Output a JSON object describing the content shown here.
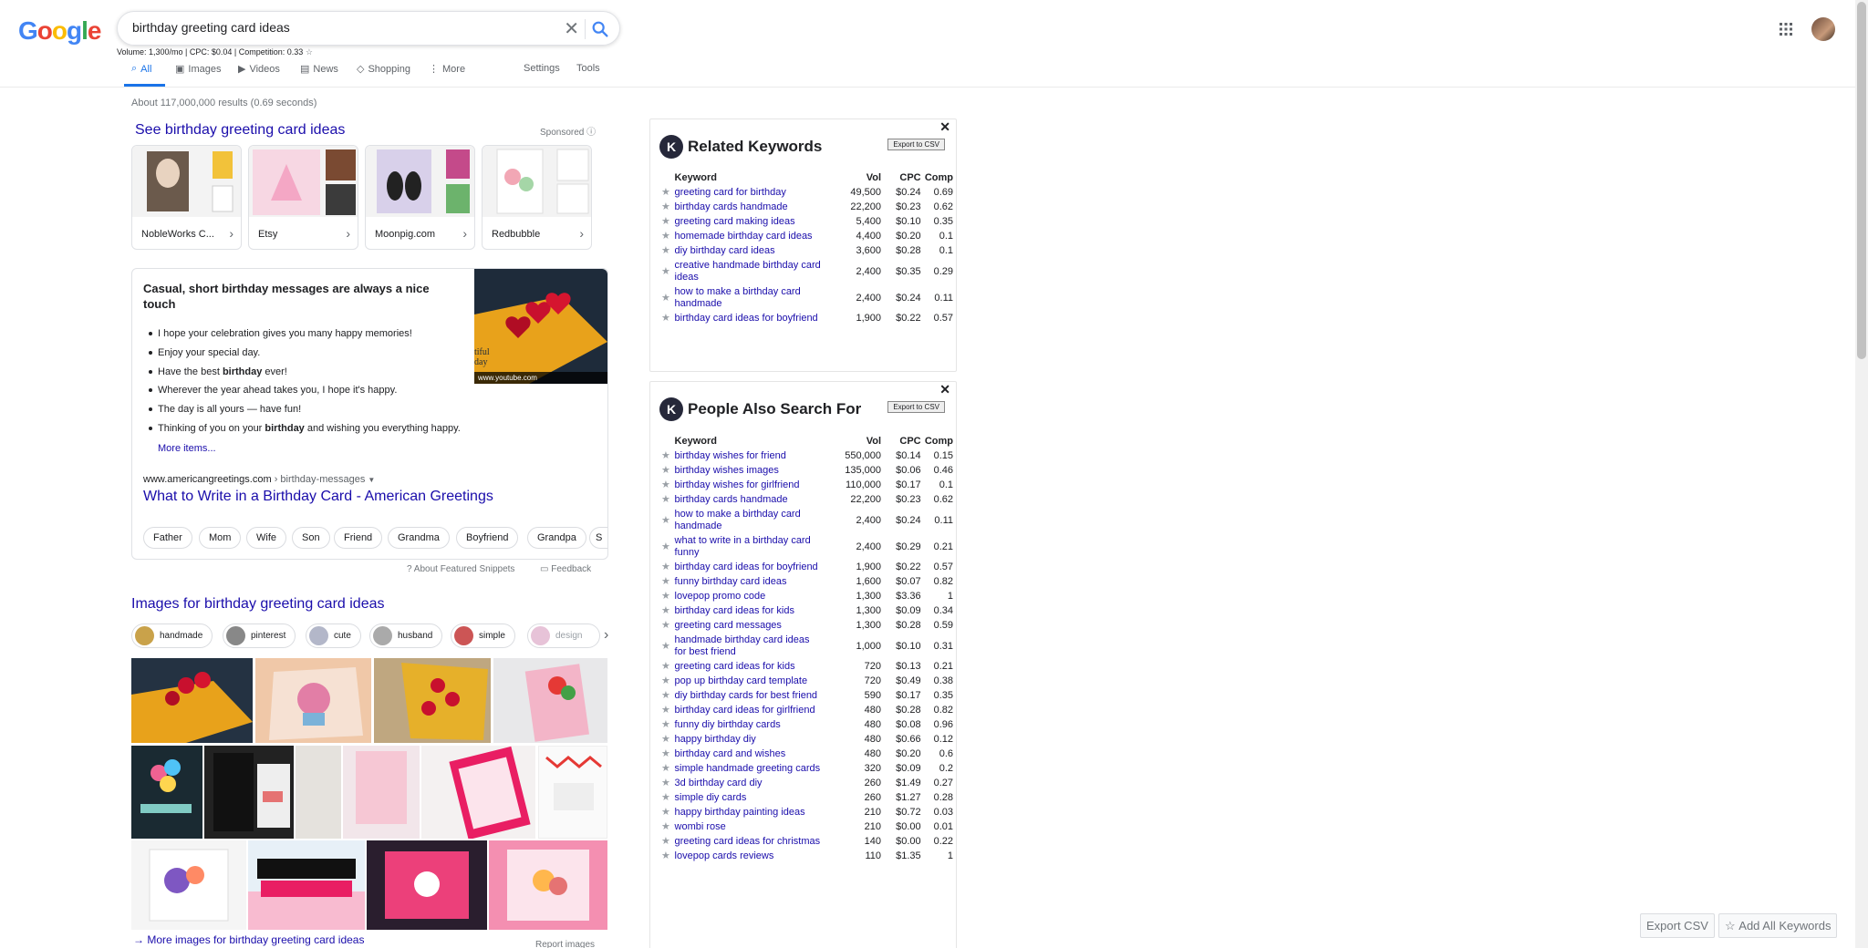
{
  "header": {
    "logo_letters": [
      "G",
      "o",
      "o",
      "g",
      "l",
      "e"
    ],
    "search_value": "birthday greeting card ideas",
    "volume_line": "Volume: 1,300/mo | CPC: $0.04 | Competition: 0.33"
  },
  "tabs": [
    {
      "label": "All",
      "icon": "search-icon"
    },
    {
      "label": "Images",
      "icon": "image-icon"
    },
    {
      "label": "Videos",
      "icon": "video-icon"
    },
    {
      "label": "News",
      "icon": "news-icon"
    },
    {
      "label": "Shopping",
      "icon": "tag-icon"
    },
    {
      "label": "More",
      "icon": "more-icon"
    },
    {
      "label": "Settings",
      "icon": ""
    },
    {
      "label": "Tools",
      "icon": ""
    }
  ],
  "results_count": "About 117,000,000 results (0.69 seconds)",
  "sponsored": {
    "title": "See birthday greeting card ideas",
    "label": "Sponsored",
    "cards": [
      {
        "name": "NobleWorks C..."
      },
      {
        "name": "Etsy"
      },
      {
        "name": "Moonpig.com"
      },
      {
        "name": "Redbubble"
      }
    ]
  },
  "snippet": {
    "heading_parts": [
      "Casual, short ",
      "birthday",
      " messages are always a nice touch"
    ],
    "items": [
      [
        "I hope your celebration gives you many happy memories!"
      ],
      [
        "Enjoy your special day."
      ],
      [
        "Have the best ",
        "birthday",
        " ever!"
      ],
      [
        "Wherever the year ahead takes you, I hope it's happy."
      ],
      [
        "The day is all yours — have fun!"
      ],
      [
        "Thinking of you on your ",
        "birthday",
        " and wishing you everything happy."
      ]
    ],
    "image_caption": "www.youtube.com",
    "image_text": "tiful day",
    "more_items": "More items...",
    "site_domain": "www.americangreetings.com",
    "site_crumb": "› birthday-messages",
    "link_title": "What to Write in a Birthday Card - American Greetings",
    "chips": [
      "Father",
      "Mom",
      "Wife",
      "Son",
      "Friend",
      "Grandma",
      "Boyfriend",
      "Grandpa",
      "S"
    ],
    "about": "About Featured Snippets",
    "feedback": "Feedback"
  },
  "images": {
    "title": "Images for birthday greeting card ideas",
    "chips": [
      "handmade",
      "pinterest",
      "cute",
      "husband",
      "simple",
      "design"
    ],
    "more": "More images for birthday greeting card ideas",
    "report": "Report images"
  },
  "related": {
    "title": "Related Keywords",
    "export": "Export to CSV",
    "columns": [
      "Keyword",
      "Vol",
      "CPC",
      "Comp"
    ],
    "rows": [
      [
        "greeting card for birthday",
        "49,500",
        "$0.24",
        "0.69"
      ],
      [
        "birthday cards handmade",
        "22,200",
        "$0.23",
        "0.62"
      ],
      [
        "greeting card making ideas",
        "5,400",
        "$0.10",
        "0.35"
      ],
      [
        "homemade birthday card ideas",
        "4,400",
        "$0.20",
        "0.1"
      ],
      [
        "diy birthday card ideas",
        "3,600",
        "$0.28",
        "0.1"
      ],
      [
        "creative handmade birthday card ideas",
        "2,400",
        "$0.35",
        "0.29"
      ],
      [
        "how to make a birthday card handmade",
        "2,400",
        "$0.24",
        "0.11"
      ],
      [
        "birthday card ideas for boyfriend",
        "1,900",
        "$0.22",
        "0.57"
      ]
    ]
  },
  "people": {
    "title": "People Also Search For",
    "export": "Export to CSV",
    "columns": [
      "Keyword",
      "Vol",
      "CPC",
      "Comp"
    ],
    "rows": [
      [
        "birthday wishes for friend",
        "550,000",
        "$0.14",
        "0.15"
      ],
      [
        "birthday wishes images",
        "135,000",
        "$0.06",
        "0.46"
      ],
      [
        "birthday wishes for girlfriend",
        "110,000",
        "$0.17",
        "0.1"
      ],
      [
        "birthday cards handmade",
        "22,200",
        "$0.23",
        "0.62"
      ],
      [
        "how to make a birthday card handmade",
        "2,400",
        "$0.24",
        "0.11"
      ],
      [
        "what to write in a birthday card funny",
        "2,400",
        "$0.29",
        "0.21"
      ],
      [
        "birthday card ideas for boyfriend",
        "1,900",
        "$0.22",
        "0.57"
      ],
      [
        "funny birthday card ideas",
        "1,600",
        "$0.07",
        "0.82"
      ],
      [
        "lovepop promo code",
        "1,300",
        "$3.36",
        "1"
      ],
      [
        "birthday card ideas for kids",
        "1,300",
        "$0.09",
        "0.34"
      ],
      [
        "greeting card messages",
        "1,300",
        "$0.28",
        "0.59"
      ],
      [
        "handmade birthday card ideas for best friend",
        "1,000",
        "$0.10",
        "0.31"
      ],
      [
        "greeting card ideas for kids",
        "720",
        "$0.13",
        "0.21"
      ],
      [
        "pop up birthday card template",
        "720",
        "$0.49",
        "0.38"
      ],
      [
        "diy birthday cards for best friend",
        "590",
        "$0.17",
        "0.35"
      ],
      [
        "birthday card ideas for girlfriend",
        "480",
        "$0.28",
        "0.82"
      ],
      [
        "funny diy birthday cards",
        "480",
        "$0.08",
        "0.96"
      ],
      [
        "happy birthday diy",
        "480",
        "$0.66",
        "0.12"
      ],
      [
        "birthday card and wishes",
        "480",
        "$0.20",
        "0.6"
      ],
      [
        "simple handmade greeting cards",
        "320",
        "$0.09",
        "0.2"
      ],
      [
        "3d birthday card diy",
        "260",
        "$1.49",
        "0.27"
      ],
      [
        "simple diy cards",
        "260",
        "$1.27",
        "0.28"
      ],
      [
        "happy birthday painting ideas",
        "210",
        "$0.72",
        "0.03"
      ],
      [
        "wombi rose",
        "210",
        "$0.00",
        "0.01"
      ],
      [
        "greeting card ideas for christmas",
        "140",
        "$0.00",
        "0.22"
      ],
      [
        "lovepop cards reviews",
        "110",
        "$1.35",
        "1"
      ]
    ]
  },
  "floating": {
    "export_csv": "Export CSV",
    "add_all": "Add All Keywords"
  },
  "colors": {
    "link": "#1a0dab",
    "accent": "#1a73e8",
    "muted": "#70757a"
  }
}
